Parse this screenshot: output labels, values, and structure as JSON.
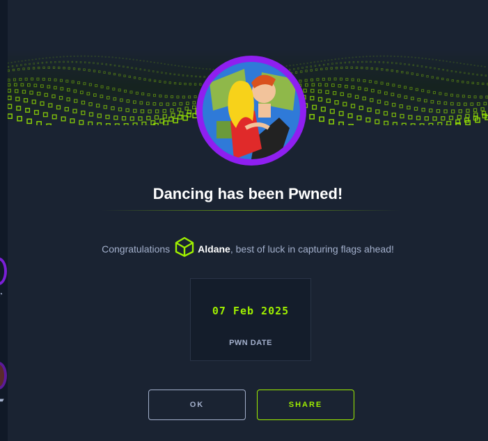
{
  "modal": {
    "title": "Dancing has been Pwned!",
    "congrats_prefix": "Congratulations",
    "username": "Aldane",
    "congrats_suffix": ", best of luck in capturing flags ahead!",
    "user_icon": "htb-cube-icon",
    "avatar_icon": "machine-avatar-dancing"
  },
  "pwn_card": {
    "date": "07 Feb 2025",
    "label": "PWN DATE"
  },
  "buttons": {
    "ok_label": "OK",
    "share_label": "SHARE"
  },
  "colors": {
    "accent": "#9fef00",
    "avatar_ring": "#8f1ff0",
    "background": "#1a2332",
    "text_muted": "#a4b1cd"
  }
}
